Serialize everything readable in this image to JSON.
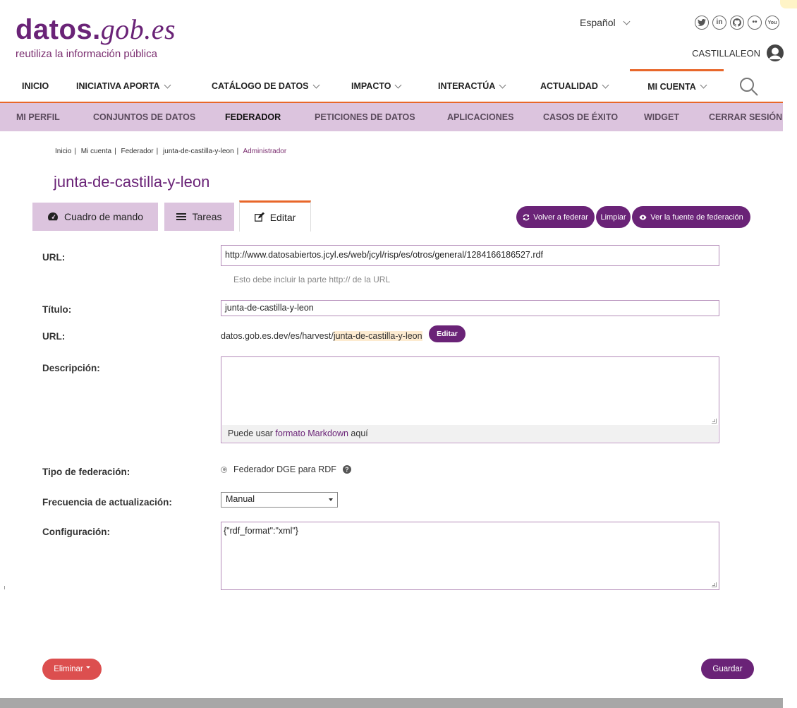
{
  "header": {
    "logo_main_bold": "datos.",
    "logo_main_italic": "gob.es",
    "tagline": "reutiliza la información pública",
    "language": "Español",
    "username": "CASTILLALEON",
    "social": [
      {
        "name": "twitter-icon",
        "glyph": "🐦"
      },
      {
        "name": "linkedin-icon",
        "glyph": "in"
      },
      {
        "name": "github-icon",
        "glyph": "gh"
      },
      {
        "name": "flickr-icon",
        "glyph": "••"
      },
      {
        "name": "youtube-icon",
        "glyph": "yt"
      }
    ]
  },
  "main_nav": [
    {
      "label": "INICIO",
      "dropdown": false
    },
    {
      "label": "INICIATIVA APORTA",
      "dropdown": true
    },
    {
      "label": "CATÁLOGO DE DATOS",
      "dropdown": true
    },
    {
      "label": "IMPACTO",
      "dropdown": true
    },
    {
      "label": "INTERACTÚA",
      "dropdown": true
    },
    {
      "label": "ACTUALIDAD",
      "dropdown": true
    },
    {
      "label": "MI CUENTA",
      "dropdown": true,
      "active": true
    }
  ],
  "sub_nav": [
    {
      "label": "MI PERFIL"
    },
    {
      "label": "CONJUNTOS DE DATOS"
    },
    {
      "label": "FEDERADOR",
      "active": true
    },
    {
      "label": "PETICIONES DE DATOS"
    },
    {
      "label": "APLICACIONES"
    },
    {
      "label": "CASOS DE ÉXITO"
    },
    {
      "label": "WIDGET"
    },
    {
      "label": "CERRAR SESIÓN"
    }
  ],
  "breadcrumb": [
    "Inicio",
    "Mi cuenta",
    "Federador",
    "junta-de-castilla-y-leon",
    "Administrador"
  ],
  "page_title": "junta-de-castilla-y-leon",
  "tabs": [
    {
      "label": "Cuadro de mando",
      "icon": "dashboard-icon"
    },
    {
      "label": "Tareas",
      "icon": "list-icon"
    },
    {
      "label": "Editar",
      "icon": "edit-icon",
      "active": true
    }
  ],
  "actions": {
    "refederate": "Volver a federar",
    "clear": "Limpiar",
    "view_source": "Ver la fuente de federación"
  },
  "form": {
    "url_label": "URL:",
    "url_value": "http://www.datosabiertos.jcyl.es/web/jcyl/risp/es/otros/general/1284166186527.rdf",
    "url_hint": "Esto debe incluir la parte http:// de la URL",
    "title_label": "Título:",
    "title_value": "junta-de-castilla-y-leon",
    "slug_label": "URL:",
    "slug_prefix": "datos.gob.es.dev/es/harvest/",
    "slug_value": "junta-de-castilla-y-leon",
    "slug_edit": "Editar",
    "description_label": "Descripción:",
    "description_value": "",
    "markdown_pre": "Puede usar ",
    "markdown_link": "formato Markdown",
    "markdown_post": " aquí",
    "type_label": "Tipo de federación:",
    "type_value": "Federador DGE para RDF",
    "freq_label": "Frecuencia de actualización:",
    "freq_value": "Manual",
    "config_label": "Configuración:",
    "config_value": "{\"rdf_format\":\"xml\"}"
  },
  "buttons": {
    "delete": "Eliminar",
    "save": "Guardar"
  },
  "colors": {
    "brand_purple": "#6a2377",
    "accent_orange": "#e8672a",
    "subnav_bg": "#dcc4de",
    "danger": "#dc4f4f"
  }
}
